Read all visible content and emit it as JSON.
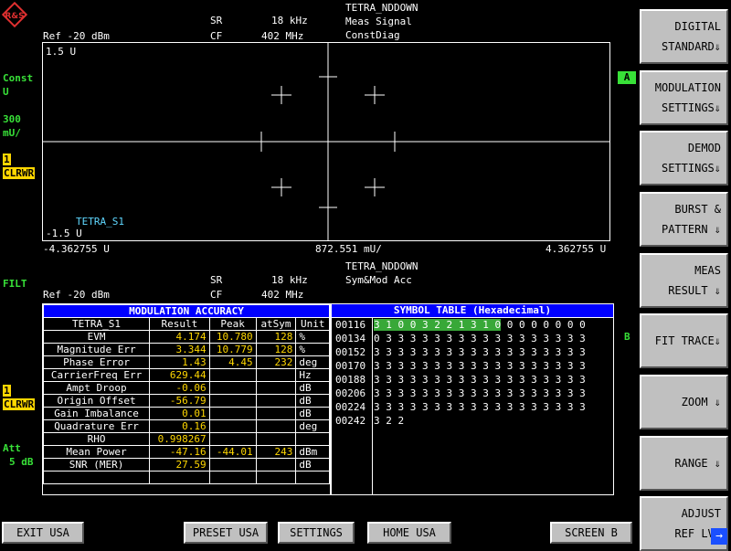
{
  "logo": "R&S",
  "top_display": {
    "ref": "Ref -20 dBm",
    "sr_label": "SR",
    "sr_value": "18 kHz",
    "cf_label": "CF",
    "cf_value": "402 MHz",
    "standard": "TETRA_NDDOWN",
    "meas_line1": "Meas Signal",
    "meas_line2": "ConstDiag",
    "ymax": "1.5 U",
    "ymin": "-1.5 U",
    "trace_name": "TETRA_S1",
    "x_left": "-4.362755 U",
    "x_center": "872.551 mU/",
    "x_right": "4.362755 U",
    "side_const1": "Const",
    "side_const2": "U",
    "side_scale1": "300",
    "side_scale2": "mU/",
    "side_trace": "1",
    "side_clrwr": "CLRWR",
    "marker_a": "A"
  },
  "bottom_display": {
    "filt": "FILT",
    "ref": "Ref -20 dBm",
    "sr_label": "SR",
    "sr_value": "18 kHz",
    "cf_label": "CF",
    "cf_value": "402 MHz",
    "standard": "TETRA_NDDOWN",
    "meas_line1": "Sym&Mod Acc",
    "side_trace": "1",
    "side_clrwr": "CLRWR",
    "att1": "Att",
    "att2": "5 dB",
    "marker_b": "B"
  },
  "mod_accuracy": {
    "title": "MODULATION ACCURACY",
    "headers": [
      "TETRA_S1",
      "Result",
      "Peak",
      "atSym",
      "Unit"
    ],
    "rows": [
      [
        "EVM",
        "4.174",
        "10.780",
        "128",
        "%"
      ],
      [
        "Magnitude Err",
        "3.344",
        "10.779",
        "128",
        "%"
      ],
      [
        "Phase Error",
        "1.43",
        "4.45",
        "232",
        "deg"
      ],
      [
        "CarrierFreq Err",
        "629.44",
        "",
        "",
        "Hz"
      ],
      [
        "Ampt Droop",
        "-0.06",
        "",
        "",
        "dB"
      ],
      [
        "Origin Offset",
        "-56.79",
        "",
        "",
        "dB"
      ],
      [
        "Gain Imbalance",
        "0.01",
        "",
        "",
        "dB"
      ],
      [
        "Quadrature Err",
        "0.16",
        "",
        "",
        "deg"
      ],
      [
        "RHO",
        "0.998267",
        "",
        "",
        ""
      ],
      [
        "Mean Power",
        "-47.16",
        "-44.01",
        "243",
        "dBm"
      ],
      [
        "SNR (MER)",
        "27.59",
        "",
        "",
        "dB"
      ],
      [
        "",
        "",
        "",
        "",
        ""
      ]
    ]
  },
  "symbol_table": {
    "title": "SYMBOL TABLE (Hexadecimal)",
    "rows": [
      {
        "addr": "00116",
        "hl": "3 1 0 0 3 2 2 1 3 1 0",
        "rest": " 0 0 0 0 0 0 0"
      },
      {
        "addr": "00134",
        "hl": "",
        "rest": "0 3 3 3 3 3 3 3 3 3 3 3 3 3 3 3 3 3"
      },
      {
        "addr": "00152",
        "hl": "",
        "rest": "3 3 3 3 3 3 3 3 3 3 3 3 3 3 3 3 3 3"
      },
      {
        "addr": "00170",
        "hl": "",
        "rest": "3 3 3 3 3 3 3 3 3 3 3 3 3 3 3 3 3 3"
      },
      {
        "addr": "00188",
        "hl": "",
        "rest": "3 3 3 3 3 3 3 3 3 3 3 3 3 3 3 3 3 3"
      },
      {
        "addr": "00206",
        "hl": "",
        "rest": "3 3 3 3 3 3 3 3 3 3 3 3 3 3 3 3 3 3"
      },
      {
        "addr": "00224",
        "hl": "",
        "rest": "3 3 3 3 3 3 3 3 3 3 3 3 3 3 3 3 3 3"
      },
      {
        "addr": "00242",
        "hl": "",
        "rest": "3 2 2"
      }
    ]
  },
  "softkeys": [
    {
      "l1": "DIGITAL",
      "l2": "STANDARD⇓"
    },
    {
      "l1": "MODULATION",
      "l2": "SETTINGS⇓"
    },
    {
      "l1": "DEMOD",
      "l2": "SETTINGS⇓"
    },
    {
      "l1": "BURST &",
      "l2": "PATTERN ⇓"
    },
    {
      "l1": "MEAS",
      "l2": "RESULT ⇓"
    },
    {
      "l1": "FIT TRACE⇓",
      "l2": ""
    },
    {
      "l1": "ZOOM  ⇓",
      "l2": ""
    },
    {
      "l1": "RANGE  ⇓",
      "l2": ""
    },
    {
      "l1": "ADJUST",
      "l2": "REF LVL"
    }
  ],
  "bottom_buttons": {
    "exit": "EXIT USA",
    "preset": "PRESET USA",
    "settings": "SETTINGS",
    "home": "HOME USA",
    "screen": "SCREEN B"
  },
  "colors": {
    "accent": "#0000ff",
    "trace": "#ffd700",
    "status": "#38e038",
    "label": "#5fd7ff"
  }
}
